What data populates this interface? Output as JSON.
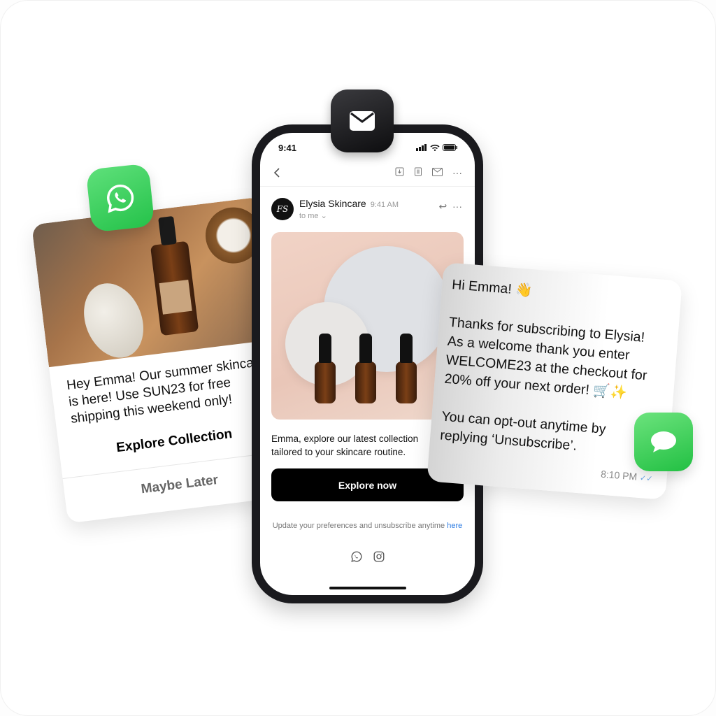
{
  "left_card": {
    "message": [
      "Hey Emma! Our summer skincare",
      "is here! Use SUN23 for free",
      "shipping this weekend only!"
    ],
    "primary_action": "Explore Collection",
    "secondary_action": "Maybe Later"
  },
  "phone": {
    "status_time": "9:41",
    "email": {
      "sender": "Elysia Skincare",
      "avatar_initials": "FS",
      "time": "9:41 AM",
      "recipient": "to me",
      "body": [
        "Emma, explore our latest collection",
        "tailored to your skincare routine."
      ],
      "button": "Explore now",
      "footer": "Update your preferences and unsubscribe anytime",
      "footer_link": "here"
    }
  },
  "right_card": {
    "greeting": "Hi Emma! 👋",
    "body": [
      "Thanks for subscribing to Elysia!",
      "As a welcome thank you enter",
      "WELCOME23 at the checkout for",
      "20% off your next order! 🛒✨"
    ],
    "optout": [
      "You can opt-out anytime by",
      "replying ‘Unsubscribe’."
    ],
    "time": "8:10 PM",
    "read_receipt": "✓✓"
  },
  "colors": {
    "whatsapp": "#25C24A",
    "imessage": "#22C043",
    "link": "#2A7AE2"
  }
}
